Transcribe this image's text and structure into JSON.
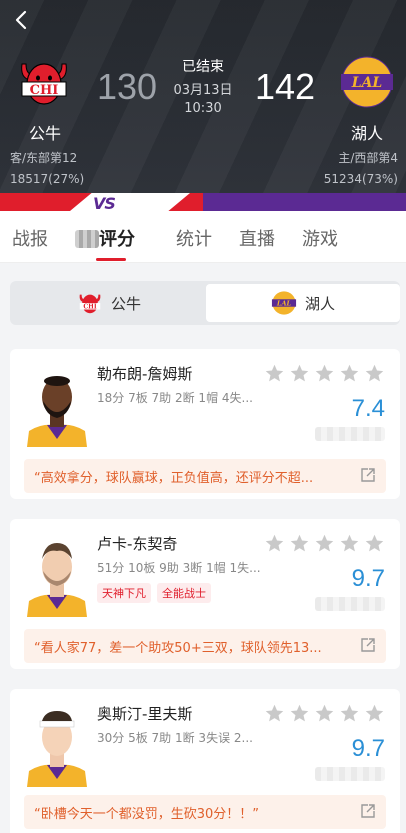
{
  "game": {
    "home": {
      "name": "公牛",
      "logo_text": "CHI",
      "rank": "客/东部第12",
      "support": "18517(27%)",
      "score": "130"
    },
    "away": {
      "name": "湖人",
      "logo_text": "LAL",
      "rank": "主/西部第4",
      "support": "51234(73%)",
      "score": "142"
    },
    "status": "已结束",
    "date": "03月13日",
    "time": "10:30"
  },
  "vs_label": "VS",
  "tabs": [
    "战报",
    "评分",
    "统计",
    "直播",
    "游戏"
  ],
  "switch": {
    "left": "公牛",
    "right": "湖人"
  },
  "players": [
    {
      "name": "勒布朗-詹姆斯",
      "stats": "18分 7板 7助 2断 1帽 4失...",
      "rating": "7.4",
      "tags": [],
      "comment": "“高效拿分，球队赢球，正负值高，还评分不超..."
    },
    {
      "name": "卢卡-东契奇",
      "stats": "51分 10板 9助 3断 1帽 1失...",
      "rating": "9.7",
      "tags": [
        "天神下凡",
        "全能战士"
      ],
      "comment": "“看人家77，差一个助攻50+三双，球队领先13..."
    },
    {
      "name": "奥斯汀-里夫斯",
      "stats": "30分 5板 7助 1断 3失误 2...",
      "rating": "9.7",
      "tags": [],
      "comment": "“卧槽今天一个都没罚，生砍30分！！”"
    }
  ],
  "colors": {
    "bulls_red": "#e01e2c",
    "lakers_purple": "#5b2a93",
    "lakers_gold": "#f3b32b",
    "rating_blue": "#2a8fd6",
    "comment_orange": "#e0602c"
  },
  "icons": {
    "back": "chevron-left-icon",
    "share": "share-icon",
    "star": "star-icon"
  }
}
